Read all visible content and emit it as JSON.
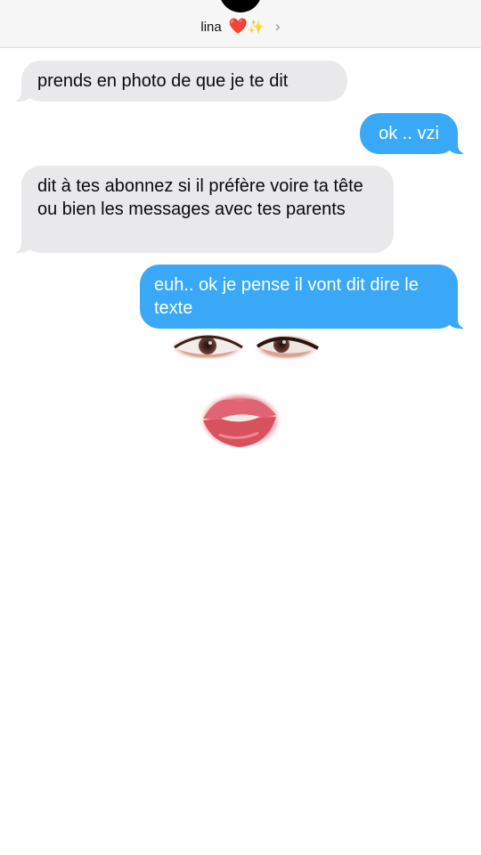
{
  "header": {
    "contact_name": "lina",
    "heart_emoji": "❤️",
    "sparkle_emoji": "✨",
    "chevron": "›"
  },
  "messages": [
    {
      "direction": "incoming",
      "text": "prends en photo de que je te dit"
    },
    {
      "direction": "outgoing",
      "text": "ok .. vzi"
    },
    {
      "direction": "incoming",
      "text": "dit à tes abonnez si il préfère voire ta tête ou bien les messages avec tes parents"
    },
    {
      "direction": "outgoing",
      "text": "euh.. ok je pense il vont dit dire le texte"
    }
  ],
  "colors": {
    "incoming_bubble": "#e9e9eb",
    "outgoing_bubble": "#38a8f7",
    "header_bg": "#f6f6f7"
  },
  "stickers": [
    "eye-sticker",
    "eye-sticker",
    "lips-sticker"
  ]
}
